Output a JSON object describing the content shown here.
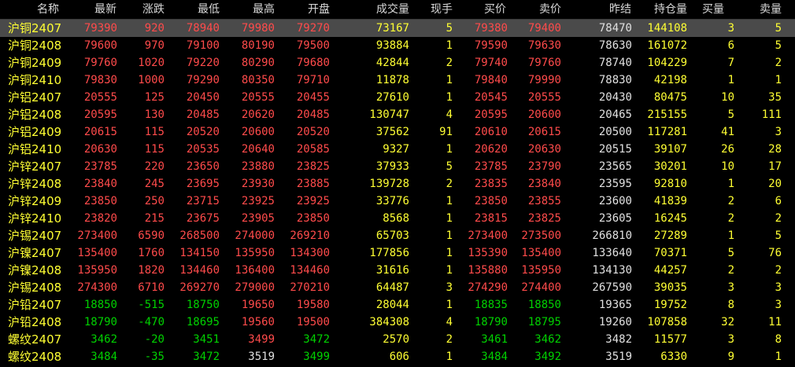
{
  "columns": [
    {
      "key": "name",
      "label": "名称"
    },
    {
      "key": "last",
      "label": "最新"
    },
    {
      "key": "change",
      "label": "涨跌"
    },
    {
      "key": "low",
      "label": "最低"
    },
    {
      "key": "high",
      "label": "最高"
    },
    {
      "key": "open",
      "label": "开盘"
    },
    {
      "key": "volume",
      "label": "成交量"
    },
    {
      "key": "current_vol",
      "label": "现手"
    },
    {
      "key": "bid",
      "label": "买价"
    },
    {
      "key": "ask",
      "label": "卖价"
    },
    {
      "key": "prev_settle",
      "label": "昨结"
    },
    {
      "key": "open_interest",
      "label": "持仓量"
    },
    {
      "key": "bid_vol",
      "label": "买量"
    },
    {
      "key": "ask_vol",
      "label": "卖量"
    }
  ],
  "colors": {
    "up": "#ff4b4b",
    "down": "#00d200",
    "flat": "#e0e0e0",
    "volume": "#ffff33",
    "name": "#ffff33",
    "selected_row": "#4a4a4a"
  },
  "selected_row": 0,
  "rows": [
    {
      "name": "沪铜2407",
      "last": "79390",
      "change": "920",
      "low": "78940",
      "high": "79980",
      "open": "79270",
      "volume": "73167",
      "current_vol": "5",
      "bid": "79380",
      "ask": "79400",
      "prev_settle": "78470",
      "open_interest": "144108",
      "bid_vol": "3",
      "ask_vol": "5"
    },
    {
      "name": "沪铜2408",
      "last": "79600",
      "change": "970",
      "low": "79100",
      "high": "80190",
      "open": "79500",
      "volume": "93884",
      "current_vol": "1",
      "bid": "79590",
      "ask": "79630",
      "prev_settle": "78630",
      "open_interest": "161072",
      "bid_vol": "6",
      "ask_vol": "5"
    },
    {
      "name": "沪铜2409",
      "last": "79760",
      "change": "1020",
      "low": "79220",
      "high": "80290",
      "open": "79680",
      "volume": "42844",
      "current_vol": "2",
      "bid": "79740",
      "ask": "79760",
      "prev_settle": "78740",
      "open_interest": "104229",
      "bid_vol": "7",
      "ask_vol": "2"
    },
    {
      "name": "沪铜2410",
      "last": "79830",
      "change": "1000",
      "low": "79290",
      "high": "80350",
      "open": "79710",
      "volume": "11878",
      "current_vol": "1",
      "bid": "79840",
      "ask": "79990",
      "prev_settle": "78830",
      "open_interest": "42198",
      "bid_vol": "1",
      "ask_vol": "1"
    },
    {
      "name": "沪铝2407",
      "last": "20555",
      "change": "125",
      "low": "20450",
      "high": "20555",
      "open": "20455",
      "volume": "27610",
      "current_vol": "1",
      "bid": "20545",
      "ask": "20555",
      "prev_settle": "20430",
      "open_interest": "80475",
      "bid_vol": "10",
      "ask_vol": "35"
    },
    {
      "name": "沪铝2408",
      "last": "20595",
      "change": "130",
      "low": "20485",
      "high": "20620",
      "open": "20485",
      "volume": "130747",
      "current_vol": "4",
      "bid": "20595",
      "ask": "20600",
      "prev_settle": "20465",
      "open_interest": "215155",
      "bid_vol": "5",
      "ask_vol": "111"
    },
    {
      "name": "沪铝2409",
      "last": "20615",
      "change": "115",
      "low": "20520",
      "high": "20600",
      "open": "20520",
      "volume": "37562",
      "current_vol": "91",
      "bid": "20610",
      "ask": "20615",
      "prev_settle": "20500",
      "open_interest": "117281",
      "bid_vol": "41",
      "ask_vol": "3"
    },
    {
      "name": "沪铝2410",
      "last": "20630",
      "change": "115",
      "low": "20535",
      "high": "20640",
      "open": "20585",
      "volume": "9327",
      "current_vol": "1",
      "bid": "20620",
      "ask": "20630",
      "prev_settle": "20515",
      "open_interest": "39107",
      "bid_vol": "26",
      "ask_vol": "28"
    },
    {
      "name": "沪锌2407",
      "last": "23785",
      "change": "220",
      "low": "23650",
      "high": "23880",
      "open": "23825",
      "volume": "37933",
      "current_vol": "5",
      "bid": "23785",
      "ask": "23790",
      "prev_settle": "23565",
      "open_interest": "30201",
      "bid_vol": "10",
      "ask_vol": "17"
    },
    {
      "name": "沪锌2408",
      "last": "23840",
      "change": "245",
      "low": "23695",
      "high": "23930",
      "open": "23885",
      "volume": "139728",
      "current_vol": "2",
      "bid": "23835",
      "ask": "23840",
      "prev_settle": "23595",
      "open_interest": "92810",
      "bid_vol": "1",
      "ask_vol": "20"
    },
    {
      "name": "沪锌2409",
      "last": "23850",
      "change": "250",
      "low": "23715",
      "high": "23925",
      "open": "23925",
      "volume": "33776",
      "current_vol": "1",
      "bid": "23850",
      "ask": "23855",
      "prev_settle": "23600",
      "open_interest": "41839",
      "bid_vol": "2",
      "ask_vol": "6"
    },
    {
      "name": "沪锌2410",
      "last": "23820",
      "change": "215",
      "low": "23675",
      "high": "23905",
      "open": "23850",
      "volume": "8568",
      "current_vol": "1",
      "bid": "23815",
      "ask": "23825",
      "prev_settle": "23605",
      "open_interest": "16245",
      "bid_vol": "2",
      "ask_vol": "2"
    },
    {
      "name": "沪锡2407",
      "last": "273400",
      "change": "6590",
      "low": "268500",
      "high": "274000",
      "open": "269210",
      "volume": "65703",
      "current_vol": "1",
      "bid": "273400",
      "ask": "273500",
      "prev_settle": "266810",
      "open_interest": "27289",
      "bid_vol": "1",
      "ask_vol": "5"
    },
    {
      "name": "沪镍2407",
      "last": "135400",
      "change": "1760",
      "low": "134150",
      "high": "135950",
      "open": "134300",
      "volume": "177856",
      "current_vol": "1",
      "bid": "135390",
      "ask": "135400",
      "prev_settle": "133640",
      "open_interest": "70371",
      "bid_vol": "5",
      "ask_vol": "76"
    },
    {
      "name": "沪镍2408",
      "last": "135950",
      "change": "1820",
      "low": "134460",
      "high": "136400",
      "open": "134460",
      "volume": "31616",
      "current_vol": "1",
      "bid": "135880",
      "ask": "135950",
      "prev_settle": "134130",
      "open_interest": "44257",
      "bid_vol": "2",
      "ask_vol": "2"
    },
    {
      "name": "沪锡2408",
      "last": "274300",
      "change": "6710",
      "low": "269270",
      "high": "279000",
      "open": "270210",
      "volume": "64487",
      "current_vol": "3",
      "bid": "274290",
      "ask": "274400",
      "prev_settle": "267590",
      "open_interest": "39035",
      "bid_vol": "3",
      "ask_vol": "3"
    },
    {
      "name": "沪铅2407",
      "last": "18850",
      "change": "-515",
      "low": "18750",
      "high": "19650",
      "open": "19580",
      "volume": "28044",
      "current_vol": "1",
      "bid": "18835",
      "ask": "18850",
      "prev_settle": "19365",
      "open_interest": "19752",
      "bid_vol": "8",
      "ask_vol": "3"
    },
    {
      "name": "沪铅2408",
      "last": "18790",
      "change": "-470",
      "low": "18695",
      "high": "19560",
      "open": "19500",
      "volume": "384308",
      "current_vol": "4",
      "bid": "18790",
      "ask": "18795",
      "prev_settle": "19260",
      "open_interest": "107858",
      "bid_vol": "32",
      "ask_vol": "11"
    },
    {
      "name": "螺纹2407",
      "last": "3462",
      "change": "-20",
      "low": "3451",
      "high": "3499",
      "open": "3472",
      "volume": "2570",
      "current_vol": "2",
      "bid": "3461",
      "ask": "3462",
      "prev_settle": "3482",
      "open_interest": "11577",
      "bid_vol": "3",
      "ask_vol": "8"
    },
    {
      "name": "螺纹2408",
      "last": "3484",
      "change": "-35",
      "low": "3472",
      "high": "3519",
      "open": "3499",
      "volume": "606",
      "current_vol": "1",
      "bid": "3484",
      "ask": "3492",
      "prev_settle": "3519",
      "open_interest": "6330",
      "bid_vol": "9",
      "ask_vol": "1"
    }
  ]
}
